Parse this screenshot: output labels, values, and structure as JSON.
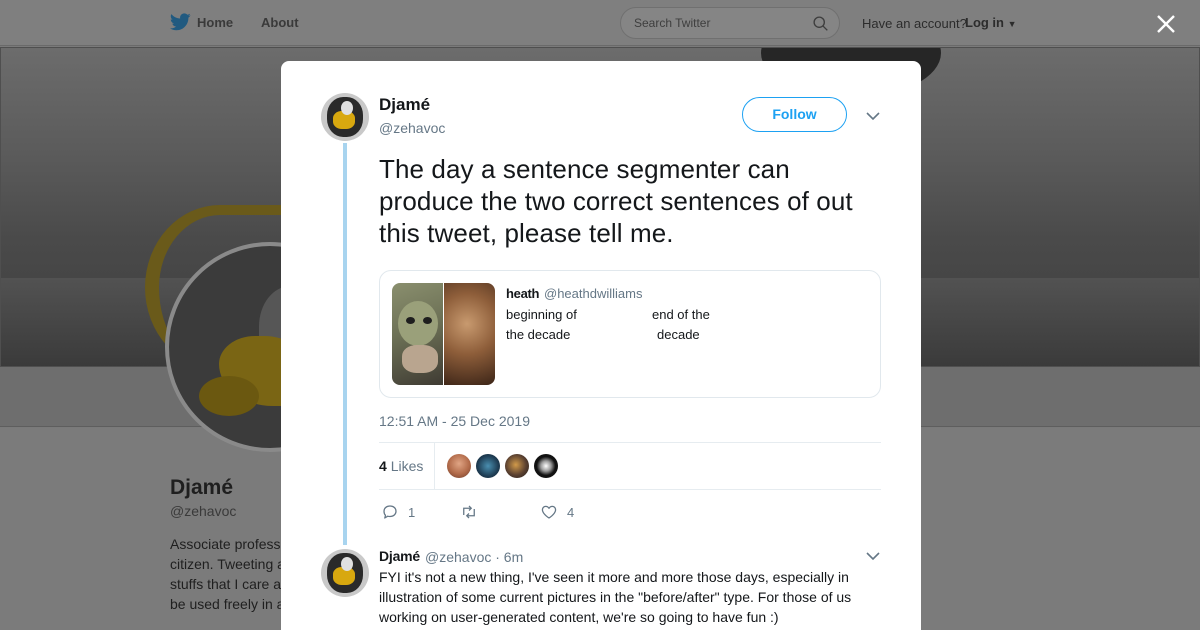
{
  "topnav": {
    "home_label": "Home",
    "about_label": "About",
    "search_placeholder": "Search Twitter",
    "have_account": "Have an account?",
    "login_label": "Log in"
  },
  "profile": {
    "name": "Djamé",
    "handle": "@zehavoc",
    "bio_lines": [
      "Associate profess",
      "citizen. Tweeting a",
      "stuffs that I care a",
      "be used freely in a"
    ]
  },
  "tweet": {
    "author_name": "Djamé",
    "author_handle": "@zehavoc",
    "follow_label": "Follow",
    "text": "The day a sentence segmenter can produce the two correct sentences of out this tweet, please tell me.",
    "quoted": {
      "name": "heath",
      "handle": "@heathdwilliams",
      "left_line1": "beginning of",
      "left_line2": "the decade",
      "right_line1": "end of the",
      "right_line2": "decade"
    },
    "timestamp": "12:51 AM - 25 Dec 2019",
    "likes_count": "4",
    "likes_label": "Likes",
    "reply_count": "1",
    "like_action_count": "4"
  },
  "reply": {
    "name": "Djamé",
    "handle": "@zehavoc",
    "time": "· 6m",
    "text": "FYI it's not a new thing, I've seen it more and more those days, especially in illustration of some current pictures in the \"before/after\" type.  For those of us working on user-generated content, we're so going to have fun :)"
  },
  "colors": {
    "accent": "#1da1f2",
    "thread_line": "#a8d4ef",
    "secondary_text": "#657786"
  }
}
